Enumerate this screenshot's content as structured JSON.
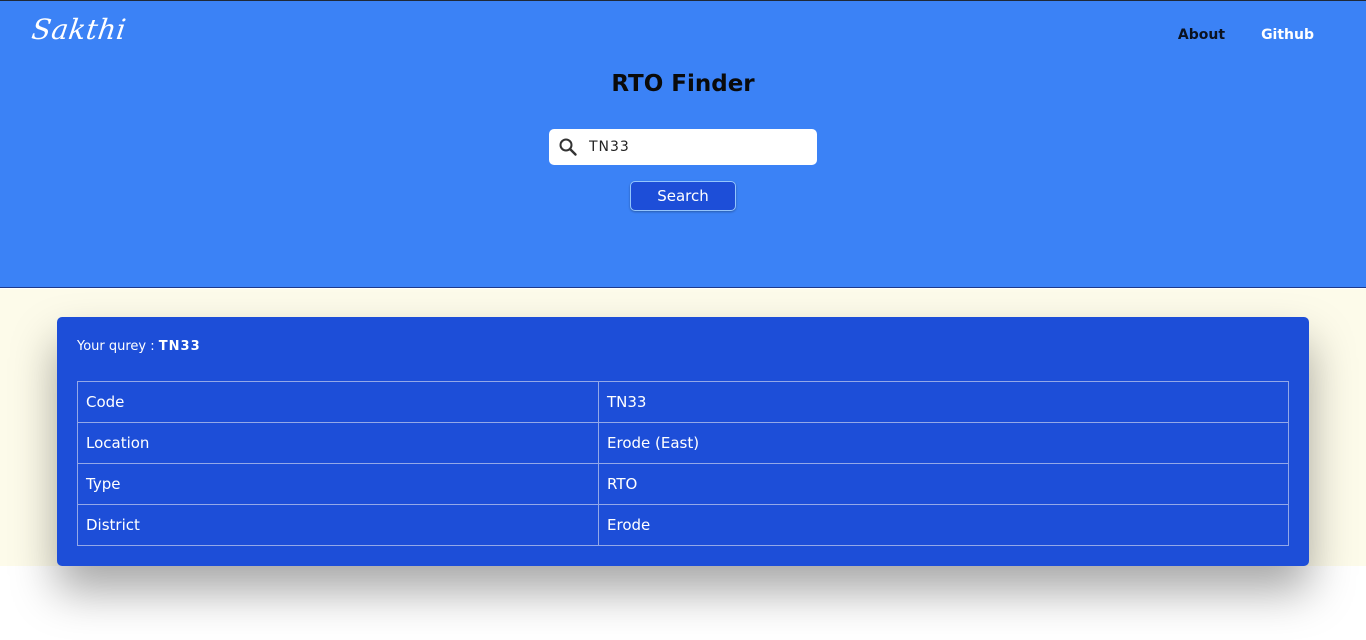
{
  "header": {
    "logo": "Sakthi",
    "nav": {
      "about": "About",
      "github": "Github"
    },
    "title": "RTO Finder"
  },
  "search": {
    "value": "TN33",
    "button_label": "Search",
    "icon": "search-icon"
  },
  "result": {
    "query_label": "Your qurey : ",
    "query_value": "TN33",
    "rows": [
      {
        "key": "Code",
        "value": "TN33"
      },
      {
        "key": "Location",
        "value": "Erode (East)"
      },
      {
        "key": "Type",
        "value": "RTO"
      },
      {
        "key": "District",
        "value": "Erode"
      }
    ]
  },
  "colors": {
    "header_bg": "#3b82f6",
    "card_bg": "#1d4ed8",
    "result_area_bg": "#fdfbea"
  }
}
